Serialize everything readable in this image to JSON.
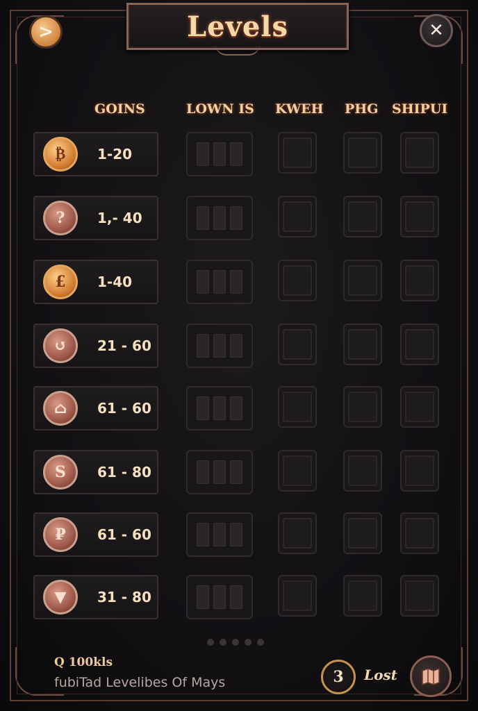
{
  "header": {
    "title": "Levels",
    "next_icon": "chevron-right-icon",
    "close_icon": "close-icon"
  },
  "columns": [
    "GOINS",
    "LOWN IS",
    "KWEH",
    "PHG",
    "SHIPUI"
  ],
  "rows": [
    {
      "coin_glyph": "₿",
      "coin_style": "gold",
      "range": "1-20"
    },
    {
      "coin_glyph": "?",
      "coin_style": "rose",
      "range": "1,- 40"
    },
    {
      "coin_glyph": "£",
      "coin_style": "gold",
      "range": "1-40"
    },
    {
      "coin_glyph": "↺",
      "coin_style": "rose",
      "range": "21 - 60"
    },
    {
      "coin_glyph": "⌂",
      "coin_style": "rose",
      "range": "61 - 60"
    },
    {
      "coin_glyph": "S",
      "coin_style": "rose",
      "range": "61 - 80"
    },
    {
      "coin_glyph": "₽",
      "coin_style": "rose",
      "range": "61 - 60"
    },
    {
      "coin_glyph": "▼",
      "coin_style": "rose",
      "range": "31 - 80"
    }
  ],
  "pagination": {
    "pages": 5,
    "current": 1
  },
  "footer": {
    "title": "Q 100kls",
    "subtitle": "fubiTad Levelibes Of Mays",
    "badge_count": "3",
    "lost_label": "Lost",
    "map_icon": "map-icon"
  },
  "colors": {
    "background": "#121013",
    "accent_gold": "#f0cfa0",
    "frame": "#5a3e37"
  }
}
